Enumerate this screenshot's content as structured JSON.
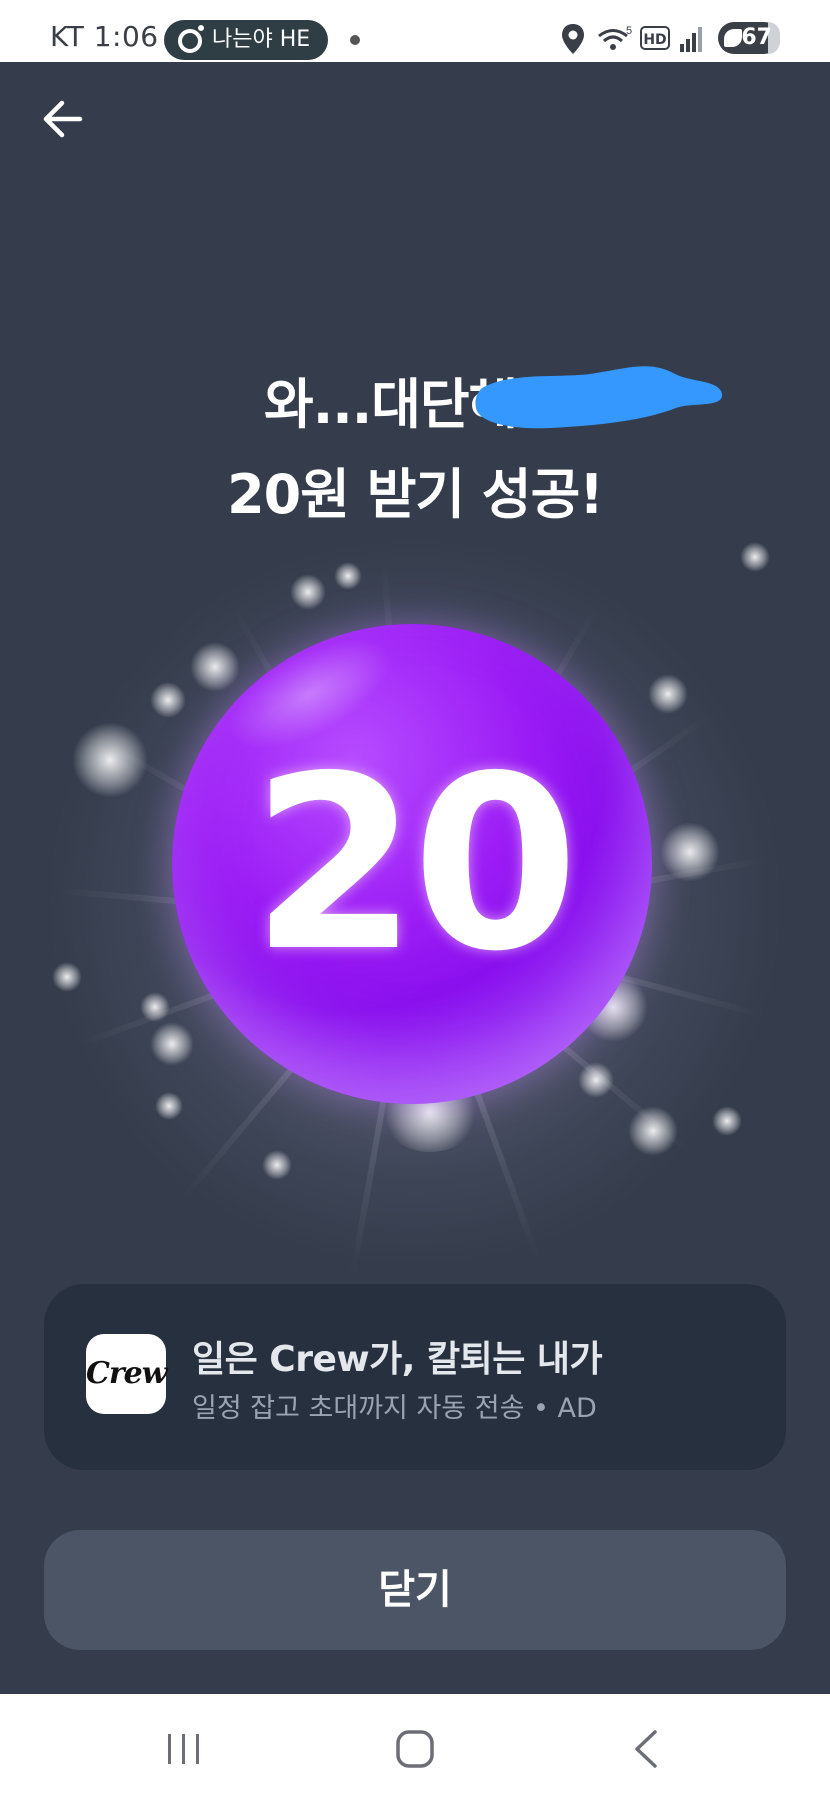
{
  "status_bar": {
    "carrier_time": "KT 1:06",
    "notification_pill": "나는야 HE",
    "network_label": "5",
    "hd_label": "HD",
    "battery": "67"
  },
  "header": {
    "back_icon": "arrow-left-icon"
  },
  "reward": {
    "headline_line1": "와...대단해요",
    "headline_line2": "20원 받기 성공!",
    "coin_value": "20",
    "coin_color": "#9b1cf5"
  },
  "ad": {
    "logo_text": "Crew",
    "title": "일은 Crew가, 칼퇴는 내가",
    "subtitle": "일정 잡고 초대까지 자동 전송 • AD"
  },
  "actions": {
    "close_label": "닫기"
  },
  "nav_bar": {
    "recents_icon": "recents-icon",
    "home_icon": "home-icon",
    "back_icon": "back-chevron-icon"
  },
  "colors": {
    "background": "#353d4c",
    "card": "#27303f",
    "button": "#4b5565",
    "redaction": "#3598ff"
  }
}
